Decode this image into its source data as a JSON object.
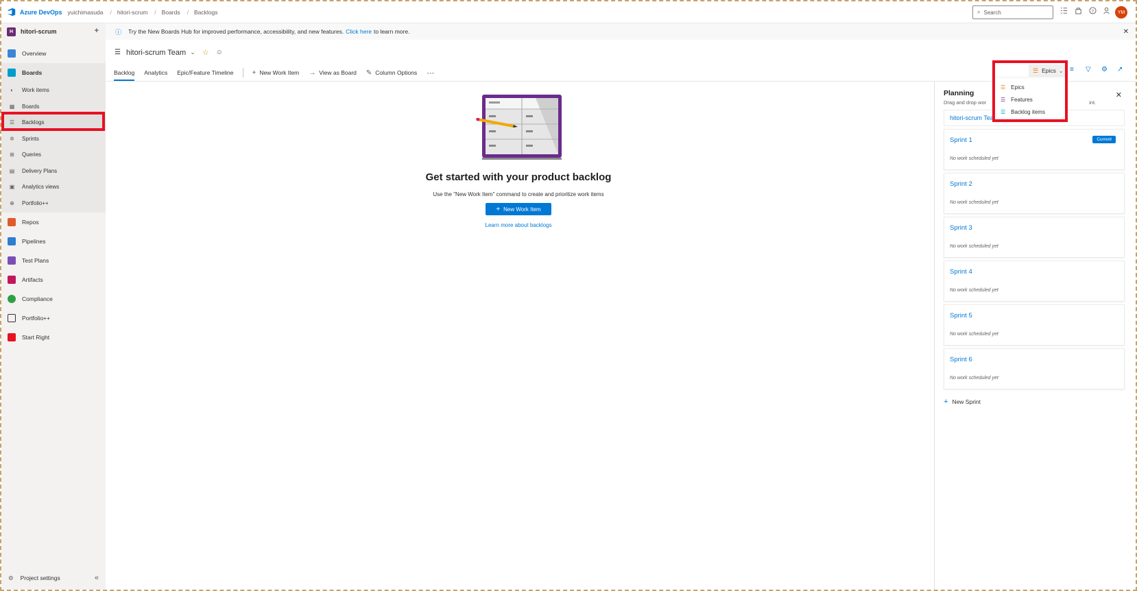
{
  "topbar": {
    "brand": "Azure DevOps",
    "breadcrumbs": [
      "yuichimasuda",
      "hitori-scrum",
      "Boards",
      "Backlogs"
    ],
    "search_placeholder": "Search",
    "avatar_initials": "YM"
  },
  "sidebar": {
    "project_initial": "H",
    "project_name": "hitori-scrum",
    "items": [
      {
        "label": "Overview",
        "color": "#3a86d6"
      },
      {
        "label": "Boards",
        "color": "#009ccc"
      },
      {
        "label": "Work items"
      },
      {
        "label": "Boards"
      },
      {
        "label": "Backlogs"
      },
      {
        "label": "Sprints"
      },
      {
        "label": "Queries"
      },
      {
        "label": "Delivery Plans"
      },
      {
        "label": "Analytics views"
      },
      {
        "label": "Portfolio++"
      },
      {
        "label": "Repos",
        "color": "#e05b2c"
      },
      {
        "label": "Pipelines",
        "color": "#2f7dd1"
      },
      {
        "label": "Test Plans",
        "color": "#7a4fb5"
      },
      {
        "label": "Artifacts",
        "color": "#c2185b"
      },
      {
        "label": "Compliance",
        "color": "#2ea043"
      },
      {
        "label": "Portfolio++",
        "color": "#323130"
      },
      {
        "label": "Start Right",
        "color": "#e81123"
      }
    ],
    "settings_label": "Project settings"
  },
  "banner": {
    "text_before": "Try the New Boards Hub for improved performance, accessibility, and new features.",
    "link": "Click here",
    "text_after": "to learn more."
  },
  "team": {
    "name": "hitori-scrum Team"
  },
  "tabs": [
    "Backlog",
    "Analytics",
    "Epic/Feature Timeline"
  ],
  "toolbar": {
    "new_work_item": "New Work Item",
    "view_as_board": "View as Board",
    "column_options": "Column Options"
  },
  "level_selector": {
    "selected": "Epics",
    "options": [
      "Epics",
      "Features",
      "Backlog items"
    ]
  },
  "empty_state": {
    "title": "Get started with your product backlog",
    "description": "Use the \"New Work Item\" command to create and prioritize work items",
    "button": "New Work Item",
    "link": "Learn more about backlogs"
  },
  "planning": {
    "title": "Planning",
    "description_start": "Drag and drop wor",
    "description_end": "int.",
    "team_backlog": "hitori-scrum Team backlog",
    "sprints": [
      {
        "name": "Sprint 1",
        "status": "No work scheduled yet",
        "badge": "Current"
      },
      {
        "name": "Sprint 2",
        "status": "No work scheduled yet"
      },
      {
        "name": "Sprint 3",
        "status": "No work scheduled yet"
      },
      {
        "name": "Sprint 4",
        "status": "No work scheduled yet"
      },
      {
        "name": "Sprint 5",
        "status": "No work scheduled yet"
      },
      {
        "name": "Sprint 6",
        "status": "No work scheduled yet"
      }
    ],
    "new_sprint": "New Sprint"
  }
}
